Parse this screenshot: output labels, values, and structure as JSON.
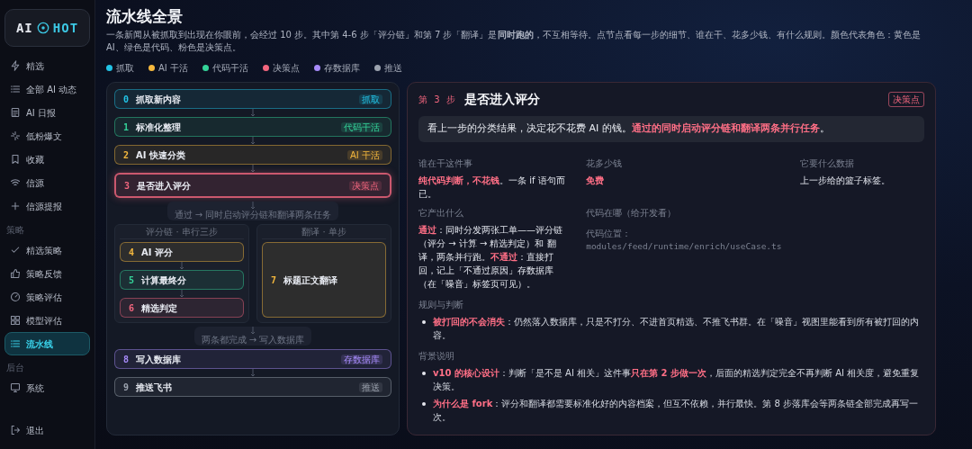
{
  "sidebar": {
    "logo": {
      "left": "AI",
      "right": "HOT"
    },
    "items": [
      {
        "kind": "bolt",
        "label": "精选",
        "selected": false
      },
      {
        "kind": "list",
        "label": "全部 AI 动态",
        "selected": false
      },
      {
        "kind": "doc",
        "label": "AI 日报",
        "selected": false
      },
      {
        "kind": "sparkle",
        "label": "低粉爆文",
        "selected": false
      },
      {
        "kind": "bookmark",
        "label": "收藏",
        "selected": false
      },
      {
        "kind": "wifi",
        "label": "信源",
        "selected": false
      },
      {
        "kind": "plus",
        "label": "信源提报",
        "selected": false
      },
      {
        "kind": "section",
        "label": "策略"
      },
      {
        "kind": "check",
        "label": "精选策略",
        "selected": false
      },
      {
        "kind": "thumb",
        "label": "策略反馈",
        "selected": false
      },
      {
        "kind": "gauge",
        "label": "策略评估",
        "selected": false
      },
      {
        "kind": "grid",
        "label": "模型评估",
        "selected": false
      },
      {
        "kind": "list",
        "label": "流水线",
        "selected": true
      },
      {
        "kind": "section",
        "label": "后台"
      },
      {
        "kind": "monitor",
        "label": "系统",
        "selected": false
      },
      {
        "kind": "logout",
        "label": "退出",
        "selected": false
      }
    ]
  },
  "header": {
    "title": "流水线全景",
    "description": "一条新闻从被抓取到出现在你眼前，会经过 10 步。其中第 4-6 步「评分链」和第 7 步「翻译」是**同时跑的**，不互相等待。点节点看每一步的细节、谁在干、花多少钱、有什么规则。颜色代表角色：黄色是 AI、绿色是代码、粉色是决策点。",
    "legend": [
      {
        "kind": "fetch",
        "label": "抓取",
        "color": "#22c3e6"
      },
      {
        "kind": "ai",
        "label": "AI 干活",
        "color": "#f5b83d"
      },
      {
        "kind": "code",
        "label": "代码干活",
        "color": "#34d399"
      },
      {
        "kind": "decision",
        "label": "决策点",
        "color": "#f2667e"
      },
      {
        "kind": "store",
        "label": "存数据库",
        "color": "#a78bfa"
      },
      {
        "kind": "push",
        "label": "推送",
        "color": "#9ca3af"
      }
    ]
  },
  "flow": {
    "steps_before": [
      {
        "number": "0",
        "title": "抓取新内容",
        "kind": "fetch",
        "tag": "抓取",
        "selected": false
      },
      {
        "number": "1",
        "title": "标准化整理",
        "kind": "code",
        "tag": "代码干活",
        "selected": false
      },
      {
        "number": "2",
        "title": "AI 快速分类",
        "kind": "ai",
        "tag": "AI 干活",
        "selected": false
      },
      {
        "number": "3",
        "title": "是否进入评分",
        "kind": "decision",
        "tag": "决策点",
        "selected": true
      }
    ],
    "fork_note": "通过 → 同时启动评分链和翻译两条任务",
    "lanes": [
      {
        "title": "评分链 · 串行三步",
        "steps": [
          {
            "number": "4",
            "title": "AI 评分",
            "kind": "ai",
            "selected": false
          },
          {
            "number": "5",
            "title": "计算最终分",
            "kind": "code",
            "selected": false
          },
          {
            "number": "6",
            "title": "精选判定",
            "kind": "decision",
            "selected": false
          }
        ]
      },
      {
        "title": "翻译 · 单步",
        "steps": [
          {
            "number": "7",
            "title": "标题正文翻译",
            "kind": "ai",
            "selected": false
          }
        ]
      }
    ],
    "join_note": "两条都完成 → 写入数据库",
    "steps_after": [
      {
        "number": "8",
        "title": "写入数据库",
        "kind": "store",
        "tag": "存数据库",
        "selected": false
      },
      {
        "number": "9",
        "title": "推送飞书",
        "kind": "push",
        "tag": "推送",
        "selected": false
      }
    ]
  },
  "detail": {
    "step_label": "第 3 步",
    "title": "是否进入评分",
    "kind": "decision",
    "tag": "决策点",
    "summary": "看上一步的分类结果，决定花不花费 AI 的钱。**通过的同时启动评分链和翻译两条并行任务**。",
    "facts": [
      {
        "label": "谁在干这件事",
        "value": "**纯代码判断，不花钱**。一条 if 语句而已。"
      },
      {
        "label": "花多少钱",
        "value": "免费",
        "emphasized": true
      },
      {
        "label": "它要什么数据",
        "value": "上一步给的篮子标签。"
      },
      {
        "label": "它产出什么",
        "value": "**通过**：同时分发两张工单——评分链（评分 → 计算 → 精选判定）和 翻译，两条并行跑。**不通过**：直接打回，记上「不通过原因」存数据库（在「噪音」标签页可见）。"
      },
      {
        "label": "代码在哪（给开发看）",
        "code_label": "代码位置：",
        "code_path": "modules/feed/runtime/enrich/useCase.ts"
      }
    ],
    "sections": [
      {
        "title": "规则与判断",
        "bullets": [
          "**被打回的不会消失**：仍然落入数据库，只是不打分、不进首页精选、不推飞书群。在「噪音」视图里能看到所有被打回的内容。"
        ]
      },
      {
        "title": "背景说明",
        "bullets": [
          "**v10 的核心设计**：判断「是不是 AI 相关」这件事**只在第 2 步做一次**，后面的精选判定完全不再判断 AI 相关度，避免重复决策。",
          "**为什么是 fork**：评分和翻译都需要标准化好的内容档案，但互不依赖，并行最快。第 8 步落库会等两条链全部完成再写一次。"
        ]
      }
    ]
  }
}
